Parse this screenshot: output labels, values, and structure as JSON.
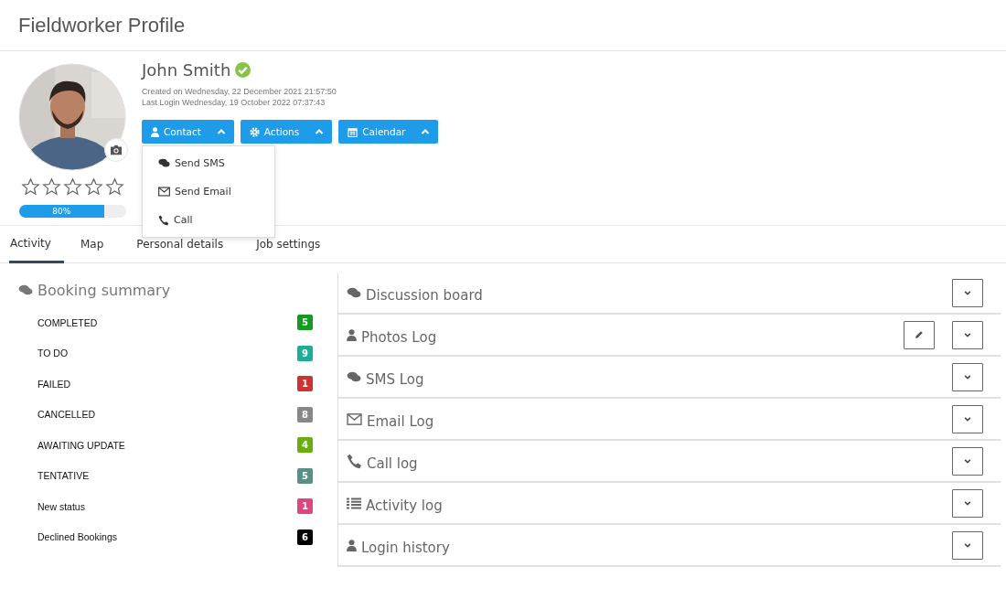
{
  "page_title": "Fieldworker Profile",
  "profile": {
    "name": "John Smith",
    "verified": true,
    "created": "Created on Wednesday, 22 December 2021 21:57:50",
    "last_login": "Last Login Wednesday, 19 October 2022 07:37:43",
    "stars": 0,
    "completion": {
      "level": 0.8,
      "label": "80%"
    }
  },
  "action_buttons": [
    {
      "label": "Contact",
      "kind": "user"
    },
    {
      "label": "Actions",
      "kind": "gear"
    },
    {
      "label": "Calendar",
      "kind": "calendar"
    }
  ],
  "contact_menu": [
    {
      "label": "Send SMS",
      "kind": "chat"
    },
    {
      "label": "Send Email",
      "kind": "envelope"
    },
    {
      "label": "Call",
      "kind": "phone"
    }
  ],
  "tabs": [
    {
      "label": "Activity",
      "selected": true
    },
    {
      "label": "Map",
      "selected": false
    },
    {
      "label": "Personal details",
      "selected": false
    },
    {
      "label": "Job settings",
      "selected": false
    }
  ],
  "booking_summary": {
    "title": "Booking summary",
    "rows": [
      {
        "label": "COMPLETED",
        "count": "5",
        "color": "#139a1f"
      },
      {
        "label": "TO DO",
        "count": "9",
        "color": "#20ab98"
      },
      {
        "label": "FAILED",
        "count": "1",
        "color": "#d03131"
      },
      {
        "label": "CANCELLED",
        "count": "8",
        "color": "#888888"
      },
      {
        "label": "AWAITING UPDATE",
        "count": "4",
        "color": "#6aae0d"
      },
      {
        "label": "TENTATIVE",
        "count": "5",
        "color": "#5a8f86"
      },
      {
        "label": "New status",
        "count": "1",
        "color": "#df4680"
      },
      {
        "label": "Declined Bookings",
        "count": "6",
        "color": "#000000"
      }
    ]
  },
  "panels": [
    {
      "title": "Discussion board",
      "kind": "chat",
      "editable": false
    },
    {
      "title": "Photos Log",
      "kind": "user",
      "editable": true
    },
    {
      "title": "SMS Log",
      "kind": "chat",
      "editable": false
    },
    {
      "title": "Email Log",
      "kind": "envelope",
      "editable": false
    },
    {
      "title": "Call log",
      "kind": "phone",
      "editable": false
    },
    {
      "title": "Activity log",
      "kind": "list",
      "editable": false
    },
    {
      "title": "Login history",
      "kind": "user",
      "editable": false
    }
  ]
}
